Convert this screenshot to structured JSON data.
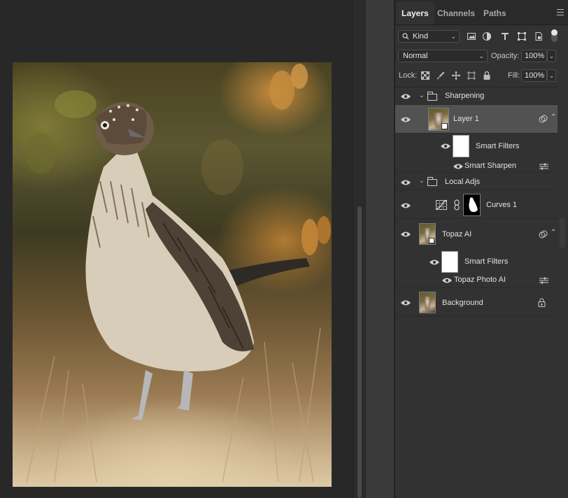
{
  "panel": {
    "tabs": [
      {
        "label": "Layers",
        "active": true
      },
      {
        "label": "Channels",
        "active": false
      },
      {
        "label": "Paths",
        "active": false
      }
    ],
    "filter": {
      "kind_label": "Kind",
      "filter_icons": [
        "image-filter-icon",
        "adjustment-filter-icon",
        "type-filter-icon",
        "shape-filter-icon",
        "smart-object-filter-icon"
      ]
    },
    "blend_mode": "Normal",
    "opacity_label": "Opacity:",
    "opacity_value": "100%",
    "lock_label": "Lock:",
    "fill_label": "Fill:",
    "fill_value": "100%",
    "layers": {
      "sharpening": {
        "name": "Sharpening"
      },
      "layer1": {
        "name": "Layer 1"
      },
      "smart_filters_1": {
        "name": "Smart Filters"
      },
      "smart_sharpen": {
        "name": "Smart Sharpen"
      },
      "local_adjs": {
        "name": "Local Adjs"
      },
      "curves1": {
        "name": "Curves 1"
      },
      "topaz": {
        "name": "Topaz AI"
      },
      "smart_filters_2": {
        "name": "Smart Filters"
      },
      "topaz_filter": {
        "name": "Topaz Photo AI"
      },
      "background": {
        "name": "Background"
      }
    }
  },
  "colors": {
    "panel_bg": "#323232",
    "selected_row": "#525252",
    "canvas_bg": "#282828"
  }
}
